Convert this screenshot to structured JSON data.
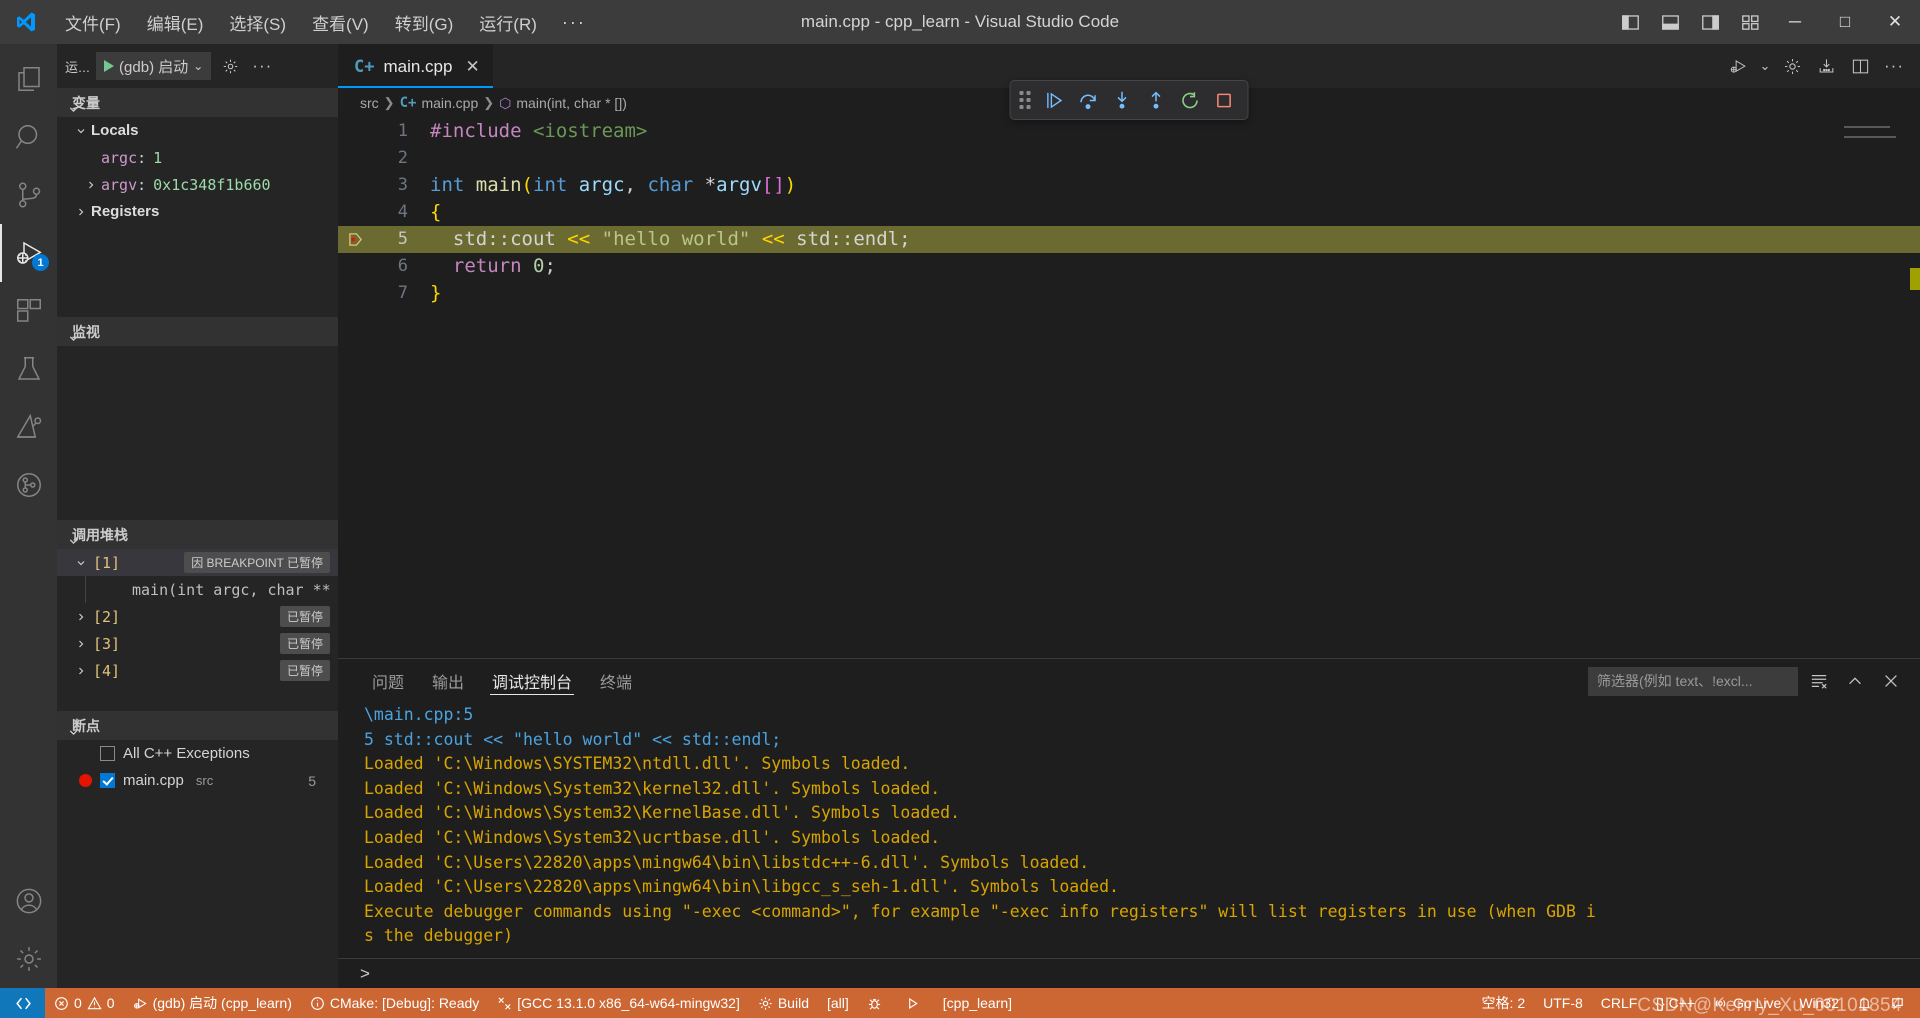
{
  "titlebar": {
    "window_title": "main.cpp - cpp_learn - Visual Studio Code",
    "menu": [
      "文件(F)",
      "编辑(E)",
      "选择(S)",
      "查看(V)",
      "转到(G)",
      "运行(R)"
    ],
    "menu_more": "···",
    "layout_icons": [
      "panel-left-icon",
      "panel-bottom-icon",
      "panel-right-icon",
      "layout-grid-icon"
    ],
    "window_controls": {
      "minimize": "─",
      "maximize": "□",
      "close": "✕"
    }
  },
  "activitybar": {
    "items": [
      {
        "name": "explorer",
        "icon": "files-icon",
        "active": false,
        "badge": ""
      },
      {
        "name": "search",
        "icon": "search-icon",
        "active": false,
        "badge": ""
      },
      {
        "name": "source-control",
        "icon": "source-control-icon",
        "active": false,
        "badge": ""
      },
      {
        "name": "run-and-debug",
        "icon": "debug-icon",
        "active": true,
        "badge": "1"
      },
      {
        "name": "extensions",
        "icon": "extensions-icon",
        "active": false,
        "badge": ""
      },
      {
        "name": "testing",
        "icon": "beaker-icon",
        "active": false,
        "badge": ""
      },
      {
        "name": "cmake",
        "icon": "cmake-icon",
        "active": false,
        "badge": ""
      },
      {
        "name": "git-graph",
        "icon": "git-graph-icon",
        "active": false,
        "badge": ""
      }
    ],
    "bottom": [
      {
        "name": "accounts",
        "icon": "account-icon"
      },
      {
        "name": "manage",
        "icon": "gear-icon"
      }
    ]
  },
  "sidebar": {
    "header": {
      "title": "运...",
      "launch_config": "(gdb) 启动",
      "chevron": "chevron-down-icon",
      "gear": "gear-icon",
      "more": "···"
    },
    "variables": {
      "section_title": "变量",
      "groups": [
        {
          "label": "Locals",
          "expanded": true
        }
      ],
      "items": [
        {
          "name": "argc",
          "value": "1",
          "expandable": false
        },
        {
          "name": "argv",
          "value": "0x1c348f1b660",
          "expandable": true
        }
      ],
      "registers_label": "Registers"
    },
    "watch": {
      "section_title": "监视",
      "items": []
    },
    "callstack": {
      "section_title": "调用堆栈",
      "frames": [
        {
          "index": "[1]",
          "badge": "因 BREAKPOINT 已暂停",
          "expanded": true,
          "selected": true,
          "sub": "main(int argc, char ** argv"
        },
        {
          "index": "[2]",
          "badge": "已暂停",
          "expanded": false,
          "selected": false,
          "sub": ""
        },
        {
          "index": "[3]",
          "badge": "已暂停",
          "expanded": false,
          "selected": false,
          "sub": ""
        },
        {
          "index": "[4]",
          "badge": "已暂停",
          "expanded": false,
          "selected": false,
          "sub": ""
        }
      ]
    },
    "breakpoints": {
      "section_title": "断点",
      "items": [
        {
          "label": "All C++ Exceptions",
          "checked": false,
          "has_dot": false,
          "sub": "",
          "count": ""
        },
        {
          "label": "main.cpp",
          "checked": true,
          "has_dot": true,
          "sub": "src",
          "count": "5"
        }
      ]
    }
  },
  "editor": {
    "tab": {
      "label": "main.cpp",
      "icon": "cpp-file-icon",
      "close": "✕"
    },
    "tab_actions": [
      "run-debug-icon",
      "gear-icon",
      "install-icon",
      "split-editor-icon",
      "more-icon"
    ],
    "debug_toolbar": [
      {
        "name": "grip-handle",
        "icon": "grip-icon"
      },
      {
        "name": "continue-button",
        "icon": "continue-icon"
      },
      {
        "name": "step-over-button",
        "icon": "step-over-icon"
      },
      {
        "name": "step-into-button",
        "icon": "step-into-icon"
      },
      {
        "name": "step-out-button",
        "icon": "step-out-icon"
      },
      {
        "name": "restart-button",
        "icon": "restart-icon"
      },
      {
        "name": "stop-button",
        "icon": "stop-icon"
      }
    ],
    "breadcrumb": [
      "src",
      "main.cpp",
      "main(int, char * [])"
    ],
    "lines": [
      {
        "num": "1",
        "text": "#include <iostream>",
        "highlight": false,
        "breakpoint": false
      },
      {
        "num": "2",
        "text": "",
        "highlight": false,
        "breakpoint": false
      },
      {
        "num": "3",
        "text": "int main(int argc, char *argv[])",
        "highlight": false,
        "breakpoint": false
      },
      {
        "num": "4",
        "text": "{",
        "highlight": false,
        "breakpoint": false
      },
      {
        "num": "5",
        "text": "  std::cout << \"hello world\" << std::endl;",
        "highlight": true,
        "breakpoint": true
      },
      {
        "num": "6",
        "text": "  return 0;",
        "highlight": false,
        "breakpoint": false
      },
      {
        "num": "7",
        "text": "}",
        "highlight": false,
        "breakpoint": false
      }
    ]
  },
  "panel": {
    "tabs": [
      {
        "label": "问题",
        "active": false
      },
      {
        "label": "输出",
        "active": false
      },
      {
        "label": "调试控制台",
        "active": true
      },
      {
        "label": "终端",
        "active": false
      }
    ],
    "filter_placeholder": "筛选器(例如 text、!excl...",
    "actions": [
      "clear-console-icon",
      "chevron-up-icon",
      "close-icon"
    ],
    "console_lines": [
      {
        "text": "\\main.cpp:5",
        "style": "blue"
      },
      {
        "text": "5        std::cout << \"hello world\" << std::endl;",
        "style": "blue-line"
      },
      {
        "text": "Loaded 'C:\\Windows\\SYSTEM32\\ntdll.dll'. Symbols loaded.",
        "style": "yellow"
      },
      {
        "text": "Loaded 'C:\\Windows\\System32\\kernel32.dll'. Symbols loaded.",
        "style": "yellow"
      },
      {
        "text": "Loaded 'C:\\Windows\\System32\\KernelBase.dll'. Symbols loaded.",
        "style": "yellow"
      },
      {
        "text": "Loaded 'C:\\Windows\\System32\\ucrtbase.dll'. Symbols loaded.",
        "style": "yellow"
      },
      {
        "text": "Loaded 'C:\\Users\\22820\\apps\\mingw64\\bin\\libstdc++-6.dll'. Symbols loaded.",
        "style": "yellow"
      },
      {
        "text": "Loaded 'C:\\Users\\22820\\apps\\mingw64\\bin\\libgcc_s_seh-1.dll'. Symbols loaded.",
        "style": "yellow"
      },
      {
        "text": "Execute debugger commands using \"-exec <command>\", for example \"-exec info registers\" will list registers in use (when GDB i",
        "style": "yellow"
      },
      {
        "text": "s the debugger)",
        "style": "yellow"
      }
    ],
    "prompt": ">"
  },
  "statusbar": {
    "remote_icon": "remote-icon",
    "left": [
      {
        "icon": "error-icon",
        "label": "0",
        "second_icon": "warning-icon",
        "second_label": "0",
        "name": "problems"
      },
      {
        "icon": "debug-alt-icon",
        "label": "(gdb) 启动 (cpp_learn)",
        "name": "launch-config"
      },
      {
        "icon": "info-icon",
        "label": "CMake: [Debug]: Ready",
        "name": "cmake-status"
      },
      {
        "icon": "tools-icon",
        "label": "[GCC 13.1.0 x86_64-w64-mingw32]",
        "name": "cmake-kit"
      },
      {
        "icon": "gear-icon",
        "label": "Build",
        "name": "cmake-build"
      },
      {
        "icon": "",
        "label": "[all]",
        "name": "cmake-target"
      },
      {
        "icon": "bug-icon",
        "label": "",
        "name": "cmake-debug"
      },
      {
        "icon": "play-icon",
        "label": "",
        "name": "cmake-run"
      },
      {
        "icon": "",
        "label": "[cpp_learn]",
        "name": "cmake-launch-target"
      }
    ],
    "right": [
      {
        "label": "空格: 2",
        "name": "indentation"
      },
      {
        "label": "UTF-8",
        "name": "encoding"
      },
      {
        "label": "CRLF",
        "name": "eol"
      },
      {
        "label": "{} C++",
        "name": "language-mode"
      },
      {
        "label": "Go Live",
        "icon": "broadcast-icon",
        "name": "go-live"
      },
      {
        "label": "Win32",
        "name": "win32"
      },
      {
        "label": "",
        "icon": "bell-icon",
        "name": "notifications"
      },
      {
        "label": "",
        "icon": "feedback-icon",
        "name": "feedback"
      }
    ],
    "watermark": "CSDN@Kenny_Xu_00101854"
  }
}
